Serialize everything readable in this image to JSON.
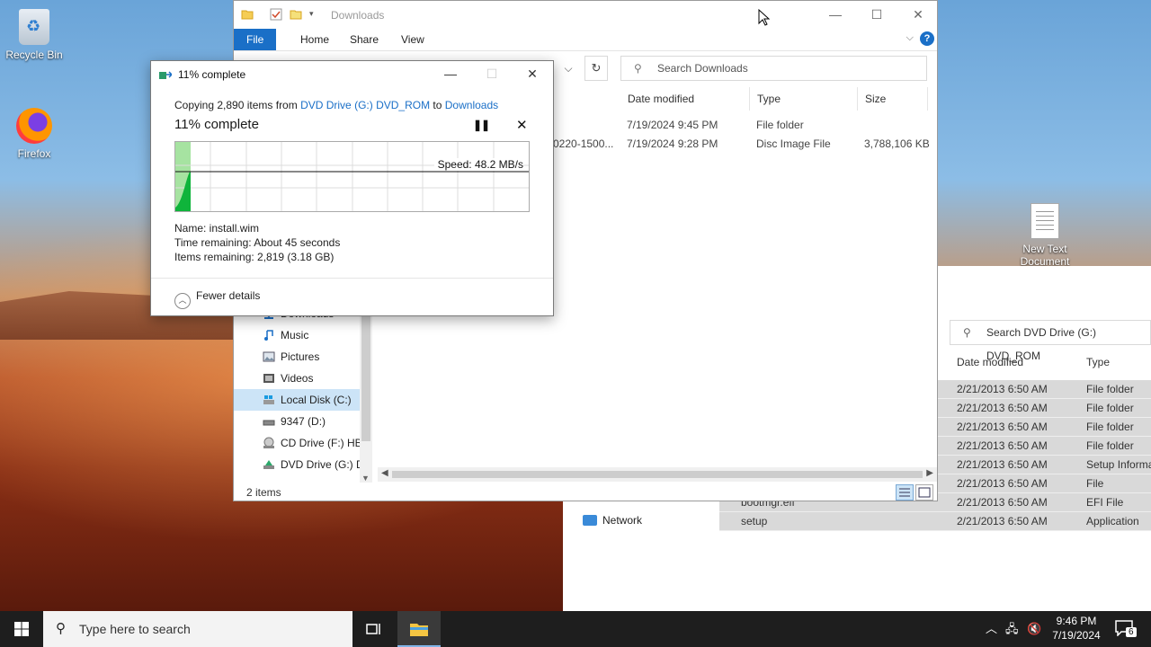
{
  "desktop": {
    "icons": [
      {
        "label": "Recycle Bin"
      },
      {
        "label": "Firefox"
      },
      {
        "label": "New Text Document"
      }
    ]
  },
  "bg_explorer": {
    "search_placeholder": "Search DVD Drive (G:) DVD_ROM",
    "columns": [
      "Date modified",
      "Type"
    ],
    "rows": [
      {
        "name": "",
        "date": "2/21/2013 6:50 AM",
        "type": "File folder"
      },
      {
        "name": "",
        "date": "2/21/2013 6:50 AM",
        "type": "File folder"
      },
      {
        "name": "",
        "date": "2/21/2013 6:50 AM",
        "type": "File folder"
      },
      {
        "name": "",
        "date": "2/21/2013 6:50 AM",
        "type": "File folder"
      },
      {
        "name": "",
        "date": "2/21/2013 6:50 AM",
        "type": "Setup Informa"
      },
      {
        "name": "",
        "date": "2/21/2013 6:50 AM",
        "type": "File"
      },
      {
        "name": "bootmgr.efi",
        "date": "2/21/2013 6:50 AM",
        "type": "EFI File"
      },
      {
        "name": "setup",
        "date": "2/21/2013 6:50 AM",
        "type": "Application"
      }
    ],
    "network_label": "Network"
  },
  "explorer": {
    "title": "Downloads",
    "ribbon_tabs": [
      "File",
      "Home",
      "Share",
      "View"
    ],
    "search_placeholder": "Search Downloads",
    "columns": [
      "Date modified",
      "Type",
      "Size"
    ],
    "files": [
      {
        "name": "",
        "date": "7/19/2024 9:45 PM",
        "type": "File folder",
        "size": ""
      },
      {
        "name": "0220-1500...",
        "date": "7/19/2024 9:28 PM",
        "type": "Disc Image File",
        "size": "3,788,106 KB"
      }
    ],
    "nav": [
      {
        "label": "Downloads"
      },
      {
        "label": "Music"
      },
      {
        "label": "Pictures"
      },
      {
        "label": "Videos"
      },
      {
        "label": "Local Disk (C:)"
      },
      {
        "label": "9347 (D:)"
      },
      {
        "label": "CD Drive (F:) HB"
      },
      {
        "label": "DVD Drive (G:) D"
      }
    ],
    "status": "2 items"
  },
  "dialog": {
    "title": "11% complete",
    "copy_prefix": "Copying 2,890 items from ",
    "source": "DVD Drive (G:) DVD_ROM",
    "copy_mid": " to ",
    "dest": "Downloads",
    "percent_label": "11% complete",
    "progress": 0.11,
    "speed": "Speed: 48.2 MB/s",
    "name_line": "Name:  install.wim",
    "time_line": "Time remaining:  About 45 seconds",
    "items_line": "Items remaining:  2,819 (3.18 GB)",
    "fewer_details": "Fewer details"
  },
  "taskbar": {
    "search_placeholder": "Type here to search",
    "time": "9:46 PM",
    "date": "7/19/2024",
    "notifications": "6"
  },
  "colors": {
    "accent": "#1a6fc7",
    "progress_green": "#0fb43b",
    "progress_light": "#a6e3a1"
  }
}
